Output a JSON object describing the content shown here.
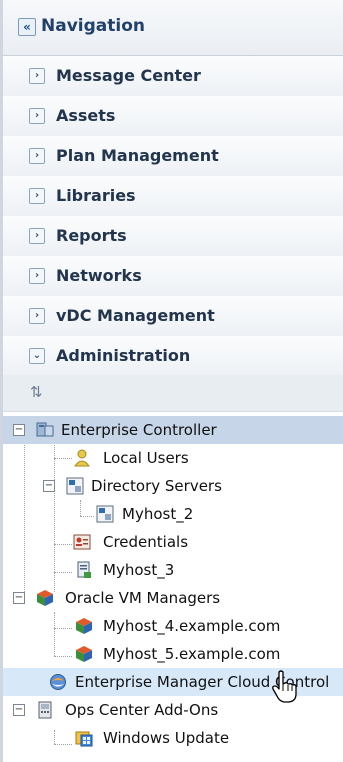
{
  "nav": {
    "title": "Navigation",
    "collapse_icon": "double-chevron-left-icon"
  },
  "accordion": [
    {
      "label": "Message Center",
      "state": "collapsed"
    },
    {
      "label": "Assets",
      "state": "collapsed"
    },
    {
      "label": "Plan Management",
      "state": "collapsed"
    },
    {
      "label": "Libraries",
      "state": "collapsed"
    },
    {
      "label": "Reports",
      "state": "collapsed"
    },
    {
      "label": "Networks",
      "state": "collapsed"
    },
    {
      "label": "vDC Management",
      "state": "collapsed"
    },
    {
      "label": "Administration",
      "state": "expanded"
    }
  ],
  "toolbar": {
    "refresh_icon": "refresh-icon"
  },
  "tree": [
    {
      "label": "Enterprise Controller",
      "icon": "enterprise-controller-icon",
      "selected": true,
      "expanded": true
    },
    {
      "label": "Local Users",
      "icon": "users-icon"
    },
    {
      "label": "Directory Servers",
      "icon": "directory-server-icon",
      "expanded": true
    },
    {
      "label": "Myhost_2",
      "icon": "directory-server-icon"
    },
    {
      "label": "Credentials",
      "icon": "credentials-icon"
    },
    {
      "label": "Myhost_3",
      "icon": "document-icon"
    },
    {
      "label": "Oracle VM Managers",
      "icon": "vm-manager-icon",
      "expanded": true
    },
    {
      "label": "Myhost_4.example.com",
      "icon": "vm-manager-icon"
    },
    {
      "label": "Myhost_5.example.com",
      "icon": "vm-manager-icon"
    },
    {
      "label": "Enterprise Manager Cloud Control",
      "icon": "cloud-control-icon",
      "hovered": true
    },
    {
      "label": "Ops Center Add-Ons",
      "icon": "addon-device-icon",
      "expanded": true
    },
    {
      "label": "Windows Update",
      "icon": "windows-update-icon"
    }
  ],
  "colors": {
    "selected_row": "#c7d5e8",
    "hover_row": "#d7e8f8",
    "header_text": "#21406a"
  }
}
